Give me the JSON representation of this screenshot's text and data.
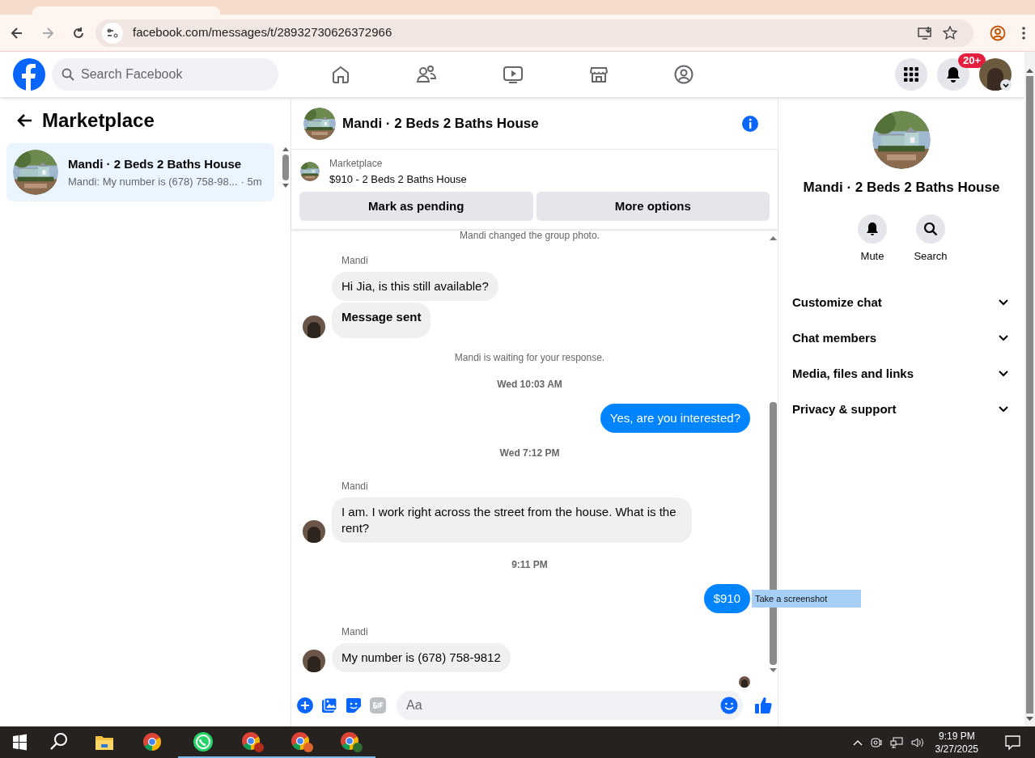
{
  "browser": {
    "url": "facebook.com/messages/t/28932730626372966"
  },
  "topnav": {
    "search_placeholder": "Search Facebook",
    "notifications_badge": "20+"
  },
  "sidebar": {
    "title": "Marketplace",
    "conversations": [
      {
        "title": "Mandi · 2 Beds 2 Baths House",
        "preview": "Mandi: My number is (678) 758-98...",
        "time": "· 5m",
        "selected": true
      }
    ]
  },
  "chat": {
    "title": "Mandi · 2 Beds 2 Baths House",
    "listing": {
      "label": "Marketplace",
      "title": "$910 - 2 Beds 2 Baths House",
      "buttons": [
        "Mark as pending",
        "More options"
      ]
    },
    "messages": [
      {
        "kind": "system",
        "text": "Mandi changed the group photo."
      },
      {
        "kind": "sender",
        "text": "Mandi"
      },
      {
        "kind": "in",
        "text": "Hi Jia, is this still available?",
        "avatar": false,
        "bold": false
      },
      {
        "kind": "in",
        "text": "Message sent",
        "avatar": true,
        "bold": true
      },
      {
        "kind": "system",
        "text": "Mandi is waiting for your response."
      },
      {
        "kind": "time",
        "text": "Wed 10:03 AM"
      },
      {
        "kind": "out",
        "text": "Yes, are you interested?"
      },
      {
        "kind": "time",
        "text": "Wed 7:12 PM"
      },
      {
        "kind": "sender",
        "text": "Mandi"
      },
      {
        "kind": "in",
        "text": "I am. I work right across the street from the house. What is the rent?",
        "avatar": true,
        "bold": false
      },
      {
        "kind": "time",
        "text": "9:11 PM"
      },
      {
        "kind": "out",
        "text": "$910",
        "tooltip": "Take a screenshot"
      },
      {
        "kind": "sender",
        "text": "Mandi"
      },
      {
        "kind": "in",
        "text": "My number is (678) 758-9812",
        "avatar": true,
        "bold": false
      },
      {
        "kind": "seen"
      }
    ],
    "composer_placeholder": "Aa"
  },
  "details": {
    "title": "Mandi · 2 Beds 2 Baths House",
    "actions": [
      "Mute",
      "Search"
    ],
    "sections": [
      {
        "label": "Customize chat",
        "expanded": false
      },
      {
        "label": "Chat members",
        "expanded": false
      },
      {
        "label": "Media, files and links",
        "expanded": false
      },
      {
        "label": "Privacy & support",
        "expanded": false
      }
    ]
  },
  "taskbar": {
    "time": "9:19 PM",
    "date": "3/27/2025"
  }
}
